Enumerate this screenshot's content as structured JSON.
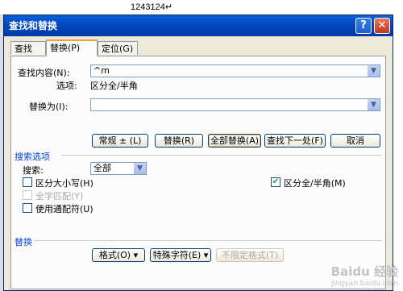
{
  "document": {
    "text": "1243124",
    "mark": "↵"
  },
  "dialog": {
    "title": "查找和替换",
    "help": "?",
    "close": "✕",
    "tabs": [
      "查找(D)",
      "替换(P)",
      "定位(G)"
    ],
    "find_label": "查找内容(N):",
    "find_value": "^m",
    "options_label": "选项:",
    "options_value": "区分全/半角",
    "replace_label": "替换为(I):",
    "replace_value": "",
    "buttons": {
      "more": "常规 ± (L)",
      "replace": "替换(R)",
      "replace_all": "全部替换(A)",
      "find_next": "查找下一处(F)",
      "cancel": "取消"
    },
    "search_options_title": "搜索选项",
    "search_label": "搜索:",
    "search_value": "全部",
    "checks": {
      "match_case": "区分大小写(H)",
      "whole_word": "全字匹配(Y)",
      "wildcards": "使用通配符(U)",
      "match_width": "区分全/半角(M)",
      "check_mark": "✔"
    },
    "replace_section_title": "替换",
    "bottom_buttons": {
      "format": "格式(O) ▾",
      "special": "特殊字符(E) ▾",
      "no_format": "不限定格式(T)"
    },
    "arrow": "▼"
  },
  "watermark": {
    "main": "Baidu 经验",
    "sub": "jingyan.baidu.com"
  }
}
